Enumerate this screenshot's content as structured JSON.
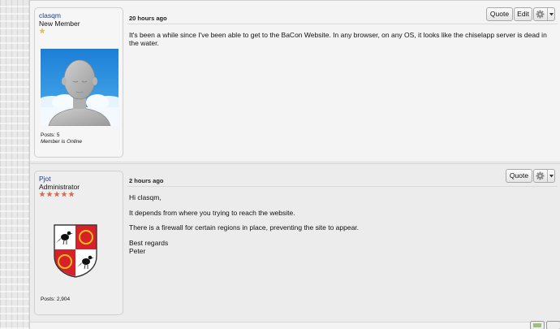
{
  "posts": [
    {
      "user": {
        "name": "clasqm",
        "title": "New Member",
        "rank_stars": 1,
        "star_color": "#e4c24a",
        "posts_label": "Posts: 5",
        "status": "Member is Online",
        "avatar": "default-avatar"
      },
      "date": "20 hours ago",
      "buttons": {
        "quote": "Quote",
        "edit": "Edit"
      },
      "body": [
        "It's been a while since I've been able to get to the BaCon Website. In any browser, on any OS, it looks like the chiselapp server is dead in the water."
      ]
    },
    {
      "user": {
        "name": "Pjot",
        "title": "Administrator",
        "rank_stars": 5,
        "star_color": "#e06a4e",
        "posts_label": "Posts: 2,904",
        "avatar": "coat-of-arms"
      },
      "date": "2 hours ago",
      "buttons": {
        "quote": "Quote"
      },
      "body": [
        "Hi clasqm,",
        "It depends from where you trying to reach the website.",
        "There is a firewall for certain regions in place, preventing the site to appear.",
        "Best regards",
        "Peter"
      ]
    }
  ],
  "colors": {
    "username_link": "#1a3e8c",
    "crest_red": "#d8202a",
    "crest_gold": "#f2c21a"
  }
}
